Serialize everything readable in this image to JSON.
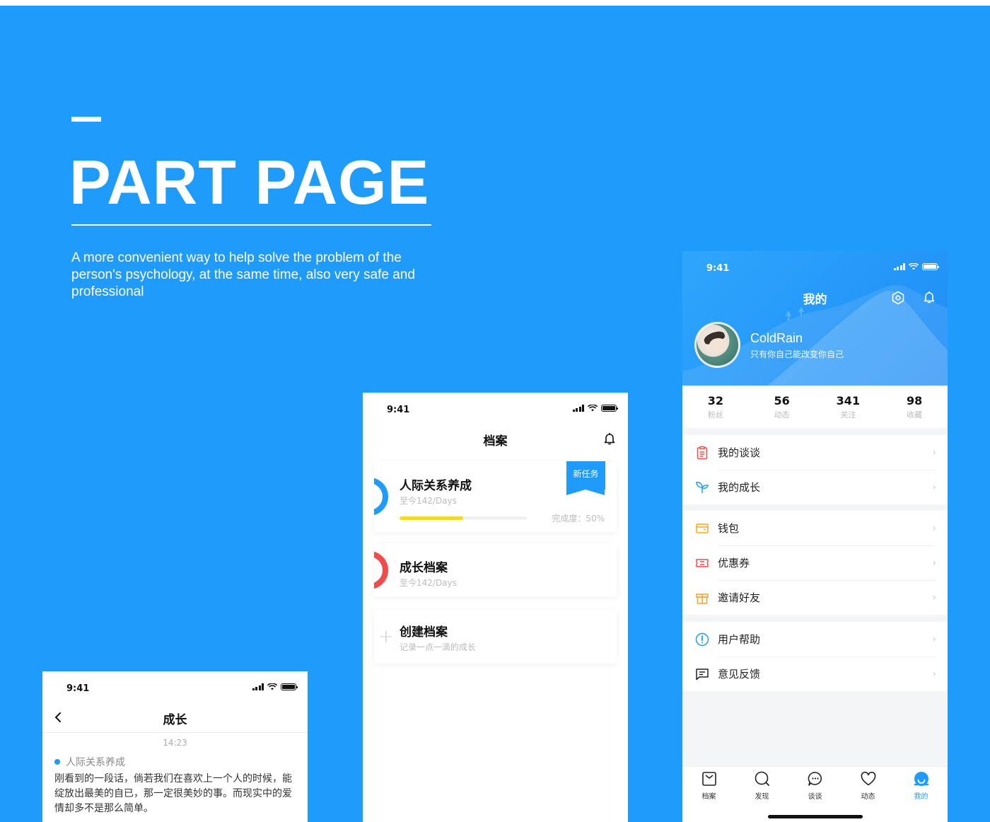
{
  "hero": {
    "title": "PART PAGE",
    "description": "A more convenient way to help solve the problem of the person's psychology, at the same time, also very safe and professional"
  },
  "status_time": "9:41",
  "growth_screen": {
    "title": "成长",
    "timestamp": "14:23",
    "tag": "人际关系养成",
    "body": "刚看到的一段话，倘若我们在喜欢上一个人的时候，能绽放出最美的自已，那一定很美妙的事。而现实中的爱情却多不是那么简单。"
  },
  "archive_screen": {
    "title": "档案",
    "cards": [
      {
        "title": "人际关系养成",
        "subtitle": "至今142/Days",
        "badge": "新任务",
        "progress_label": "完成度：50%",
        "progress": 0.5,
        "ring_color": "#1E9BFB"
      },
      {
        "title": "成长档案",
        "subtitle": "至今142/Days",
        "ring_color": "#F24B4B"
      },
      {
        "title": "创建档案",
        "subtitle": "记录一点一滴的成长",
        "icon": "plus-icon"
      }
    ],
    "progress_color": "#F9D71C"
  },
  "profile_screen": {
    "title": "我的",
    "username": "ColdRain",
    "motto": "只有你自己能改变你自己",
    "stats": [
      {
        "value": "32",
        "label": "粉丝"
      },
      {
        "value": "56",
        "label": "动态"
      },
      {
        "value": "341",
        "label": "关注"
      },
      {
        "value": "98",
        "label": "收藏"
      }
    ],
    "menu_groups": [
      [
        {
          "label": "我的谈谈",
          "icon": "clipboard-icon",
          "color": "#F24B4B"
        },
        {
          "label": "我的成长",
          "icon": "sprout-icon",
          "color": "#1E9BFB"
        }
      ],
      [
        {
          "label": "钱包",
          "icon": "wallet-icon",
          "color": "#F5A623"
        },
        {
          "label": "优惠券",
          "icon": "ticket-icon",
          "color": "#F24B4B"
        },
        {
          "label": "邀请好友",
          "icon": "gift-icon",
          "color": "#F5A623"
        }
      ],
      [
        {
          "label": "用户帮助",
          "icon": "help-icon",
          "color": "#1E9BFB"
        },
        {
          "label": "意见反馈",
          "icon": "feedback-icon",
          "color": "#222222"
        }
      ]
    ],
    "tabs": [
      {
        "label": "档案",
        "icon": "archive-tab-icon"
      },
      {
        "label": "发现",
        "icon": "discover-tab-icon"
      },
      {
        "label": "谈谈",
        "icon": "chat-tab-icon"
      },
      {
        "label": "动态",
        "icon": "heart-tab-icon"
      },
      {
        "label": "我的",
        "icon": "profile-tab-icon",
        "active": true
      }
    ]
  },
  "colors": {
    "background": "#1E9BFB",
    "accent": "#1E9BFB",
    "danger": "#F24B4B",
    "warning": "#F5A623"
  }
}
